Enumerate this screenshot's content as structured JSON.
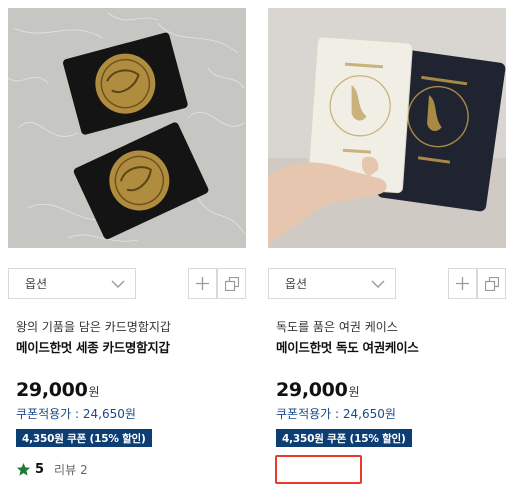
{
  "products": [
    {
      "option_label": "옵션",
      "subtitle": "왕의 기품을 담은 카드명함지갑",
      "name": "메이드한멋 세종 카드명함지갑",
      "price": "29,000",
      "currency": "원",
      "coupon_price": "쿠폰적용가 : 24,650원",
      "coupon_badge": "4,350원 쿠폰 (15% 할인)",
      "rating": "5",
      "review_label": "리뷰",
      "review_count": "2",
      "image_icon": "card-wallet-photo"
    },
    {
      "option_label": "옵션",
      "subtitle": "독도를 품은 여권 케이스",
      "name": "메이드한멋 독도 여권케이스",
      "price": "29,000",
      "currency": "원",
      "coupon_price": "쿠폰적용가 : 24,650원",
      "coupon_badge": "4,350원 쿠폰 (15% 할인)",
      "image_icon": "passport-case-photo"
    }
  ],
  "colors": {
    "badge_bg": "#0d3e73",
    "coupon_text": "#1a4a8a",
    "star": "#1f7a3a",
    "highlight_box": "#e83b2e"
  }
}
